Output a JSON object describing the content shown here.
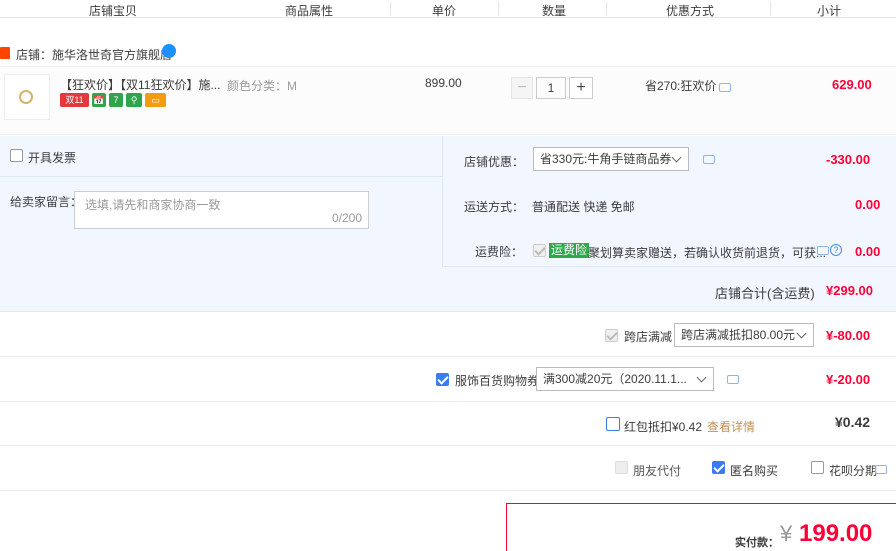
{
  "header": {
    "col_shop_item": "店铺宝贝",
    "col_attributes": "商品属性",
    "col_unit_price": "单价",
    "col_quantity": "数量",
    "col_discount": "优惠方式",
    "col_subtotal": "小计"
  },
  "shop": {
    "badge": "天猫",
    "name": "店铺：施华洛世奇官方旗舰店"
  },
  "item": {
    "title": "【狂欢价】【双11狂欢价】施...",
    "tags": [
      "双11",
      "📅",
      "7",
      "⚲",
      "▭"
    ],
    "sku": "颜色分类：M",
    "unit_price": "899.00",
    "quantity": "1",
    "minus": "−",
    "plus": "+",
    "discount": "省270:狂欢价",
    "subtotal": "629.00"
  },
  "panel": {
    "invoice_label": "开具发票",
    "message_label": "给卖家留言：",
    "message_placeholder": "选填,请先和商家协商一致",
    "message_count": "0/200",
    "shop_discount_label": "店铺优惠：",
    "shop_discount_value": "省330元:牛角手链商品券",
    "shop_discount_amount": "-330.00",
    "shipping_label": "运送方式：",
    "shipping_value": "普通配送 快递 免邮",
    "shipping_amount": "0.00",
    "insurance_label": "运费险：",
    "insurance_tag": "运费险",
    "insurance_desc": "聚划算卖家赠送，若确认收货前退货，可获...",
    "insurance_amount": "0.00",
    "shop_total_label": "店铺合计(含运费)",
    "shop_total_amount": "¥299.00"
  },
  "cross_store": {
    "label": "跨店满减",
    "select_value": "跨店满减抵扣80.00元",
    "amount": "¥-80.00"
  },
  "coupon": {
    "label": "服饰百货购物券",
    "select_value": "满300减20元（2020.11.1...",
    "amount": "¥-20.00"
  },
  "redpacket": {
    "label": "红包抵扣¥0.42",
    "link": "查看详情",
    "amount": "¥0.42"
  },
  "options": {
    "friend_pay": "朋友代付",
    "anonymous": "匿名购买",
    "huabei": "花呗分期"
  },
  "final": {
    "label": "实付款：",
    "yen": "¥",
    "amount": "199.00"
  },
  "colors": {
    "accent_red": "#ff0036",
    "panel_blue": "#f2f7ff",
    "checkbox_blue": "#3b7df0"
  }
}
